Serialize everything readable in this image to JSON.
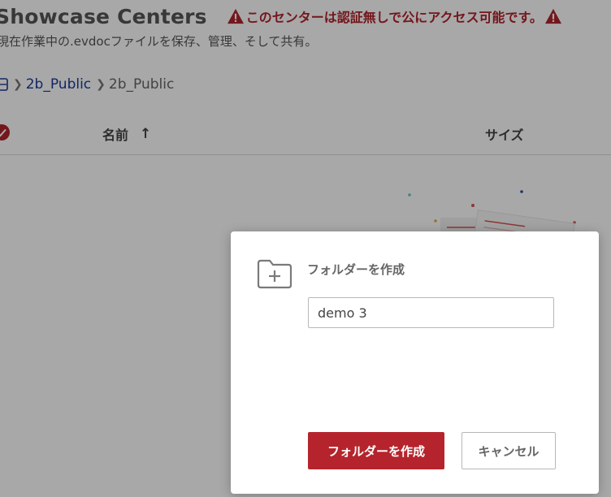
{
  "header": {
    "title": "Showcase Centers",
    "warning": "このセンターは認証無しで公にアクセス可能です。",
    "subtitle": "現在作業中の.evdocファイルを保存、管理、そして共有。"
  },
  "breadcrumb": {
    "items": [
      {
        "label": "2b_Public"
      },
      {
        "label": "2b_Public"
      }
    ]
  },
  "table": {
    "columns": {
      "name": "名前",
      "size": "サイズ"
    }
  },
  "dialog": {
    "title": "フォルダーを作成",
    "input_value": "demo 3",
    "create_label": "フォルダーを作成",
    "cancel_label": "キャンセル"
  },
  "colors": {
    "accent": "#b5242c",
    "link": "#1a3a9a",
    "overlay": "rgba(0,0,0,0.34)"
  }
}
